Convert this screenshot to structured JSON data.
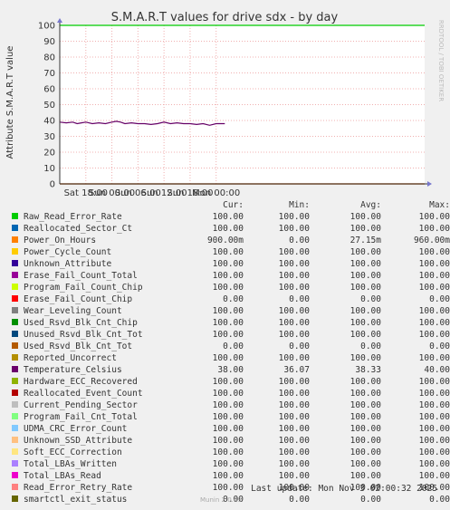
{
  "chart_data": {
    "type": "line",
    "title": "S.M.A.R.T values for drive sdx - by day",
    "ylabel": "Attribute S.M.A.R.T value",
    "side_label": "RRDTOOL / TOBI OETIKER",
    "ylim": [
      0,
      100
    ],
    "yticks": [
      0,
      10,
      20,
      30,
      40,
      50,
      60,
      70,
      80,
      90,
      100
    ],
    "xlim_hours": [
      -6,
      78
    ],
    "xticks": [
      {
        "label": "Sat 18:00",
        "hour": 0
      },
      {
        "label": "Sun 00:00",
        "hour": 6
      },
      {
        "label": "Sun 06:00",
        "hour": 12
      },
      {
        "label": "Sun 12:00",
        "hour": 18
      },
      {
        "label": "Sun 18:00",
        "hour": 24
      },
      {
        "label": "Mon 00:00",
        "hour": 30
      }
    ],
    "plotted_series": [
      {
        "name": "Raw_Read_Error_Rate",
        "value": 100,
        "color": "#00cc00"
      },
      {
        "name": "Temperature_Celsius",
        "color": "#660066",
        "x_hours": [
          -6,
          -4.5,
          -3,
          -2,
          -1,
          0,
          1.5,
          3,
          4.5,
          6,
          7,
          8,
          9,
          10.5,
          12,
          13.5,
          15,
          16.5,
          18,
          19.5,
          21,
          22.5,
          24,
          25.5,
          27,
          28.5,
          30,
          31,
          32
        ],
        "values": [
          39,
          38.5,
          39,
          38,
          38.5,
          39,
          38,
          38.5,
          38,
          39,
          39.5,
          39,
          38,
          38.5,
          38,
          38,
          37.5,
          38,
          39,
          38,
          38.5,
          38,
          38,
          37.5,
          38,
          37,
          38,
          38,
          38
        ]
      },
      {
        "name": "Erase_Fail_Count_Chip",
        "value": 0,
        "color": "#cc0000"
      },
      {
        "name": "Reported_Uncorrect",
        "value": 0,
        "color": "#cc9900"
      }
    ]
  },
  "legend": {
    "headers": {
      "cur": "Cur:",
      "min": "Min:",
      "avg": "Avg:",
      "max": "Max:"
    },
    "rows": [
      {
        "name": "Raw_Read_Error_Rate",
        "color": "#00cc00",
        "cur": "100.00",
        "min": "100.00",
        "avg": "100.00",
        "max": "100.00"
      },
      {
        "name": "Reallocated_Sector_Ct",
        "color": "#0066b3",
        "cur": "100.00",
        "min": "100.00",
        "avg": "100.00",
        "max": "100.00"
      },
      {
        "name": "Power_On_Hours",
        "color": "#ff8000",
        "cur": "900.00m",
        "min": "0.00",
        "avg": "27.15m",
        "max": "960.00m"
      },
      {
        "name": "Power_Cycle_Count",
        "color": "#ffcc00",
        "cur": "100.00",
        "min": "100.00",
        "avg": "100.00",
        "max": "100.00"
      },
      {
        "name": "Unknown_Attribute",
        "color": "#330099",
        "cur": "100.00",
        "min": "100.00",
        "avg": "100.00",
        "max": "100.00"
      },
      {
        "name": "Erase_Fail_Count_Total",
        "color": "#990099",
        "cur": "100.00",
        "min": "100.00",
        "avg": "100.00",
        "max": "100.00"
      },
      {
        "name": "Program_Fail_Count_Chip",
        "color": "#ccff00",
        "cur": "100.00",
        "min": "100.00",
        "avg": "100.00",
        "max": "100.00"
      },
      {
        "name": "Erase_Fail_Count_Chip",
        "color": "#ff0000",
        "cur": "0.00",
        "min": "0.00",
        "avg": "0.00",
        "max": "0.00"
      },
      {
        "name": "Wear_Leveling_Count",
        "color": "#808080",
        "cur": "100.00",
        "min": "100.00",
        "avg": "100.00",
        "max": "100.00"
      },
      {
        "name": "Used_Rsvd_Blk_Cnt_Chip",
        "color": "#008f00",
        "cur": "100.00",
        "min": "100.00",
        "avg": "100.00",
        "max": "100.00"
      },
      {
        "name": "Unused_Rsvd_Blk_Cnt_Tot",
        "color": "#00487d",
        "cur": "100.00",
        "min": "100.00",
        "avg": "100.00",
        "max": "100.00"
      },
      {
        "name": "Used_Rsvd_Blk_Cnt_Tot",
        "color": "#b35a00",
        "cur": "0.00",
        "min": "0.00",
        "avg": "0.00",
        "max": "0.00"
      },
      {
        "name": "Reported_Uncorrect",
        "color": "#b38f00",
        "cur": "100.00",
        "min": "100.00",
        "avg": "100.00",
        "max": "100.00"
      },
      {
        "name": "Temperature_Celsius",
        "color": "#6b006b",
        "cur": "38.00",
        "min": "36.07",
        "avg": "38.33",
        "max": "40.00"
      },
      {
        "name": "Hardware_ECC_Recovered",
        "color": "#8fb300",
        "cur": "100.00",
        "min": "100.00",
        "avg": "100.00",
        "max": "100.00"
      },
      {
        "name": "Reallocated_Event_Count",
        "color": "#b30000",
        "cur": "100.00",
        "min": "100.00",
        "avg": "100.00",
        "max": "100.00"
      },
      {
        "name": "Current_Pending_Sector",
        "color": "#bebebe",
        "cur": "100.00",
        "min": "100.00",
        "avg": "100.00",
        "max": "100.00"
      },
      {
        "name": "Program_Fail_Cnt_Total",
        "color": "#80ff80",
        "cur": "100.00",
        "min": "100.00",
        "avg": "100.00",
        "max": "100.00"
      },
      {
        "name": "UDMA_CRC_Error_Count",
        "color": "#80c9ff",
        "cur": "100.00",
        "min": "100.00",
        "avg": "100.00",
        "max": "100.00"
      },
      {
        "name": "Unknown_SSD_Attribute",
        "color": "#ffc080",
        "cur": "100.00",
        "min": "100.00",
        "avg": "100.00",
        "max": "100.00"
      },
      {
        "name": "Soft_ECC_Correction",
        "color": "#ffe680",
        "cur": "100.00",
        "min": "100.00",
        "avg": "100.00",
        "max": "100.00"
      },
      {
        "name": "Total_LBAs_Written",
        "color": "#aa80ff",
        "cur": "100.00",
        "min": "100.00",
        "avg": "100.00",
        "max": "100.00"
      },
      {
        "name": "Total_LBAs_Read",
        "color": "#ee00cc",
        "cur": "100.00",
        "min": "100.00",
        "avg": "100.00",
        "max": "100.00"
      },
      {
        "name": "Read_Error_Retry_Rate",
        "color": "#ff8080",
        "cur": "100.00",
        "min": "100.00",
        "avg": "100.00",
        "max": "100.00"
      },
      {
        "name": "smartctl_exit_status",
        "color": "#666600",
        "cur": "0.00",
        "min": "0.00",
        "avg": "0.00",
        "max": "0.00"
      }
    ]
  },
  "footer": {
    "last_update": "Last update: Mon Nov  3 02:00:32 2025",
    "version": "Munin 2.0.49"
  }
}
